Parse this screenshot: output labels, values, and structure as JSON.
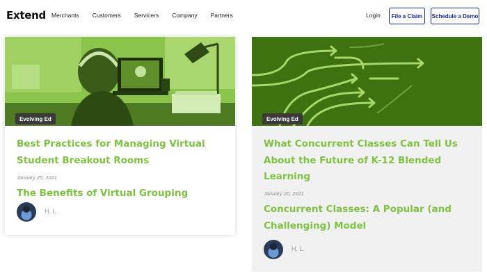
{
  "nav": {
    "logo": "Extend",
    "links": [
      "Merchants",
      "Customers",
      "Servicers",
      "Company",
      "Partners"
    ],
    "login": "Login",
    "file_claim": "File a Claim",
    "schedule_demo": "Schedule a Demo"
  },
  "colors": {
    "accent_green": "#7fc241",
    "button_navy": "#1a2a8a",
    "badge_bg": "#3a3a3a"
  },
  "cards": [
    {
      "badge": "Evolving Ed",
      "title_line1": "Best Practices for Managing Virtual",
      "title_line2": "Student Breakout Rooms",
      "date": "January 25, 2021",
      "subtitle_line1": "The Benefits of Virtual Grouping",
      "author": "H. L."
    },
    {
      "badge": "Evolving Ed",
      "title_line1": "What Concurrent Classes Can Tell Us",
      "title_line2": "About the Future of K-12 Blended",
      "title_line3": "Learning",
      "date": "January 20, 2021",
      "subtitle_line1": "Concurrent Classes: A Popular (and",
      "subtitle_line2": "Challenging) Model",
      "author": "H. L."
    }
  ]
}
